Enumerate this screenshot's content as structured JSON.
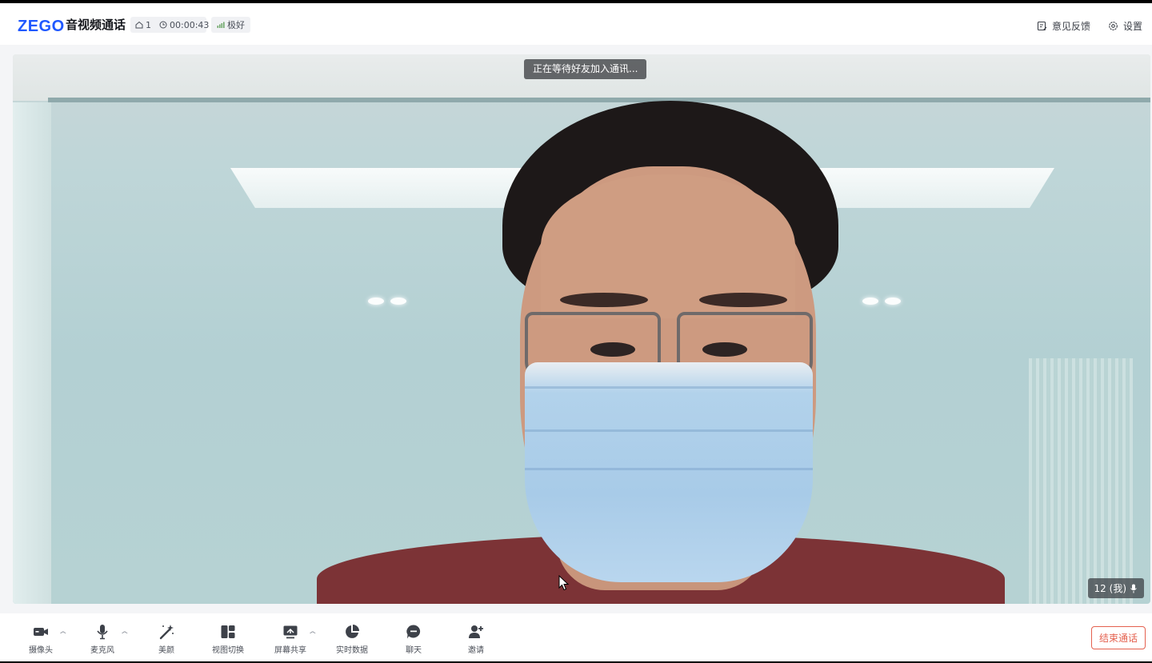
{
  "header": {
    "logo": "ZEGO",
    "title": "音视频通话",
    "room_count": "1",
    "duration": "00:00:43",
    "network_quality": "极好",
    "feedback_label": "意见反馈",
    "settings_label": "设置"
  },
  "video": {
    "waiting_text": "正在等待好友加入通讯...",
    "self_name": "12 (我)"
  },
  "toolbar": {
    "camera": "摄像头",
    "microphone": "麦克风",
    "beauty": "美颜",
    "view_switch": "视图切换",
    "screen_share": "屏幕共享",
    "realtime_data": "实时数据",
    "chat": "聊天",
    "invite": "邀请",
    "end_call": "结束通话"
  },
  "colors": {
    "brand": "#1f58ff",
    "end_call": "#e4614f"
  }
}
